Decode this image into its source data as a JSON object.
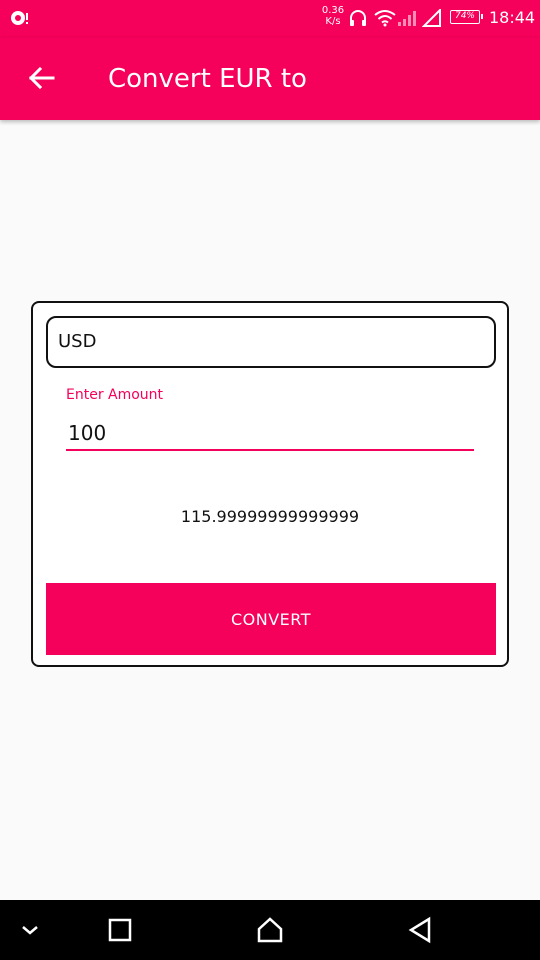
{
  "status_bar": {
    "speed_value": "0.36",
    "speed_unit": "K/s",
    "battery": "74%",
    "time": "18:44",
    "icons": [
      "notification-icon",
      "headphones-icon",
      "wifi-icon",
      "cell-signal-icon",
      "battery-icon"
    ]
  },
  "app_bar": {
    "title": "Convert EUR to",
    "back_icon": "arrow-back-icon"
  },
  "form": {
    "currency": "USD",
    "amount_label": "Enter Amount",
    "amount_value": "100",
    "result": "115.99999999999999",
    "convert_label": "CONVERT"
  },
  "nav_bar": {
    "icons": [
      "chevron-down-icon",
      "recents-icon",
      "home-icon",
      "back-icon"
    ]
  },
  "colors": {
    "accent": "#f5005a",
    "background": "#fafafa"
  }
}
